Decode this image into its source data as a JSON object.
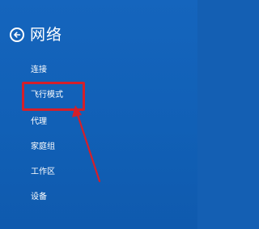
{
  "header": {
    "title": "网络",
    "back_icon": "back-arrow-circle-icon"
  },
  "menu": {
    "items": [
      {
        "label": "连接"
      },
      {
        "label": "飞行模式"
      },
      {
        "label": "代理"
      },
      {
        "label": "家庭组"
      },
      {
        "label": "工作区"
      },
      {
        "label": "设备"
      }
    ]
  },
  "annotation": {
    "highlight_color": "#d51f2a",
    "arrow_color": "#d51f2a"
  },
  "colors": {
    "background": "#1160b6",
    "text": "#ffffff"
  }
}
